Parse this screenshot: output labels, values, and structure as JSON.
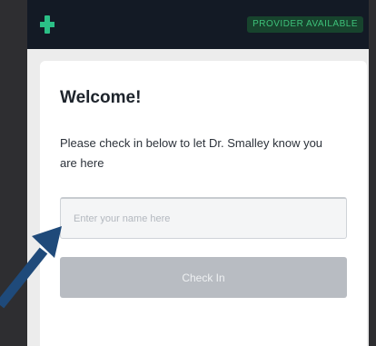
{
  "header": {
    "logo_icon": "plus-logo-icon",
    "status_badge": "PROVIDER AVAILABLE",
    "status_color": "#3ec27a"
  },
  "checkin": {
    "title": "Welcome!",
    "instructions": "Please check in below to let Dr. Smalley know you are here",
    "name_input": {
      "placeholder": "Enter your name here",
      "value": ""
    },
    "button_label": "Check In"
  },
  "annotation": {
    "arrow_icon": "pointer-arrow-icon",
    "arrow_color": "#1f4a7a"
  }
}
